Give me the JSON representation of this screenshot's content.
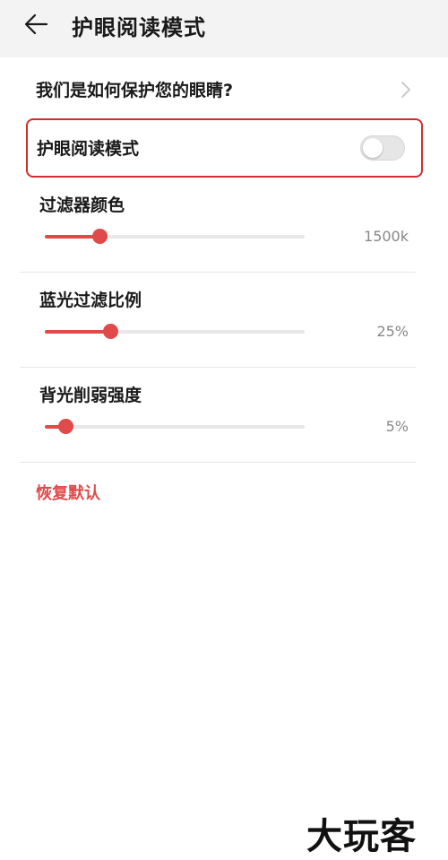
{
  "colors": {
    "accent": "#e04a4a",
    "highlight_border": "#cf2e2e"
  },
  "header": {
    "title": "护眼阅读模式",
    "back_icon": "arrow-left-icon"
  },
  "info_link": {
    "label": "我们是如何保护您的眼睛?",
    "icon": "chevron-right-icon"
  },
  "toggle": {
    "label": "护眼阅读模式",
    "checked": false
  },
  "sliders": [
    {
      "label": "过滤器颜色",
      "value_text": "1500k",
      "fraction": 0.21
    },
    {
      "label": "蓝光过滤比例",
      "value_text": "25%",
      "fraction": 0.25
    },
    {
      "label": "背光削弱强度",
      "value_text": "5%",
      "fraction": 0.08
    }
  ],
  "reset": {
    "label": "恢复默认"
  },
  "watermark": {
    "text": "大玩客"
  }
}
